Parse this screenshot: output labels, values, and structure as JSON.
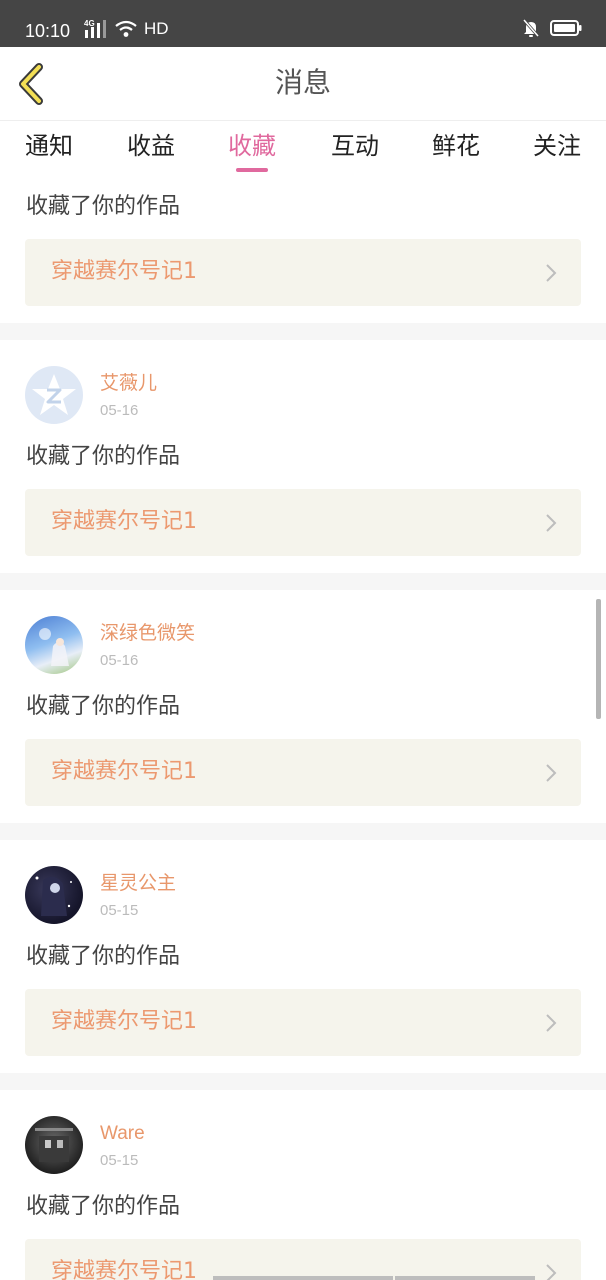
{
  "status_bar": {
    "time": "10:10",
    "network_type": "4G",
    "hd_label": "HD"
  },
  "header": {
    "title": "消息",
    "back_icon": "chevron-left-icon"
  },
  "tabs": [
    {
      "label": "通知"
    },
    {
      "label": "收益"
    },
    {
      "label": "收藏",
      "active": true
    },
    {
      "label": "互动"
    },
    {
      "label": "鲜花"
    },
    {
      "label": "关注"
    }
  ],
  "colors": {
    "accent": "#e0699e",
    "username": "#e8976b",
    "work_title": "#ec9970",
    "work_bg": "#f5f4ec"
  },
  "items": [
    {
      "action": "收藏了你的作品",
      "work_title": "穿越赛尔号记1"
    },
    {
      "username": "艾薇儿",
      "date": "05-16",
      "action": "收藏了你的作品",
      "work_title": "穿越赛尔号记1"
    },
    {
      "username": "深绿色微笑",
      "date": "05-16",
      "action": "收藏了你的作品",
      "work_title": "穿越赛尔号记1"
    },
    {
      "username": "星灵公主",
      "date": "05-15",
      "action": "收藏了你的作品",
      "work_title": "穿越赛尔号记1"
    },
    {
      "username": "Ware",
      "date": "05-15",
      "action": "收藏了你的作品",
      "work_title": "穿越赛尔号记1"
    }
  ]
}
